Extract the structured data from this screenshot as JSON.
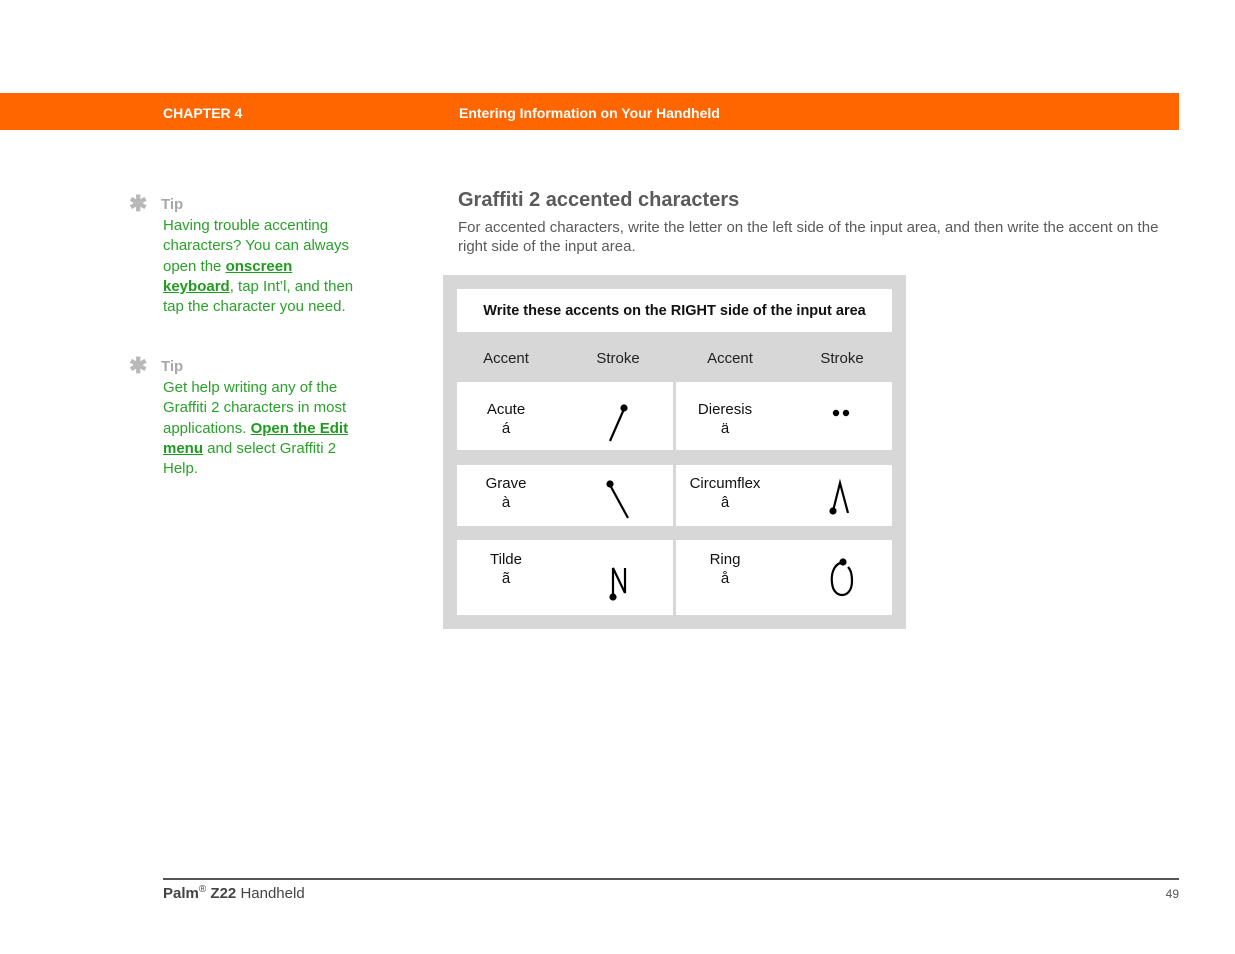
{
  "header": {
    "chapter": "CHAPTER 4",
    "title": "Entering Information on Your Handheld",
    "accent_color": "#ff6600"
  },
  "tips": [
    {
      "label": "Tip",
      "icon": "asterisk-icon",
      "text_before": "Having trouble accenting characters? You can always open the ",
      "link": "onscreen keyboard",
      "text_after": ", tap Int’l, and then tap the character you need."
    },
    {
      "label": "Tip",
      "icon": "asterisk-icon",
      "text_before": "Get help writing any of the Graffiti 2 characters in most applications. ",
      "link": "Open the Edit menu",
      "text_after": " and select Graffiti 2 Help."
    }
  ],
  "section": {
    "heading": "Graffiti 2 accented characters",
    "intro": "For accented characters, write the letter on the left side of the input area, and then write the accent on the right side of the input area."
  },
  "table": {
    "caption": "Write these accents on the RIGHT side of the input area",
    "column_headers": [
      "Accent",
      "Stroke",
      "Accent",
      "Stroke"
    ],
    "rows": [
      [
        {
          "name": "Acute",
          "char": "á",
          "stroke": "acute-stroke-icon"
        },
        {
          "name": "Dieresis",
          "char": "ä",
          "stroke": "dieresis-stroke-icon"
        }
      ],
      [
        {
          "name": "Grave",
          "char": "à",
          "stroke": "grave-stroke-icon"
        },
        {
          "name": "Circumflex",
          "char": "â",
          "stroke": "circumflex-stroke-icon"
        }
      ],
      [
        {
          "name": "Tilde",
          "char": "ã",
          "stroke": "tilde-stroke-icon"
        },
        {
          "name": "Ring",
          "char": "å",
          "stroke": "ring-stroke-icon"
        }
      ]
    ]
  },
  "footer": {
    "brand": "Palm",
    "registered": "®",
    "model": "Z22",
    "product": "Handheld",
    "page_number": "49"
  }
}
